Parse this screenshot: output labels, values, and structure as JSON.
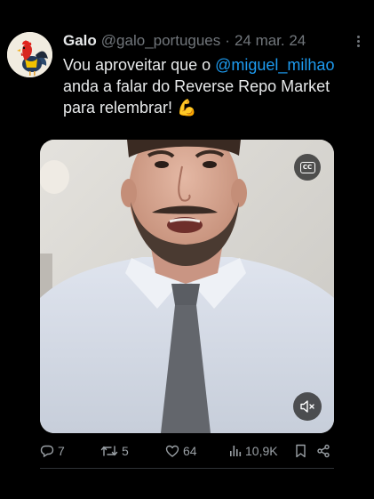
{
  "tweet": {
    "author_name": "Galo",
    "handle": "@galo_portugues",
    "separator": "·",
    "date": "24 mar. 24",
    "text_prefix": "Vou aproveitar que o ",
    "mention": "@miguel_milhao",
    "text_line2": "anda a falar do Reverse Repo Market",
    "text_line3": "para relembrar! 💪"
  },
  "video": {
    "captions_icon": "cc-icon",
    "captions_label": "CC",
    "mute_icon": "speaker-muted-icon"
  },
  "actions": {
    "replies": "7",
    "reposts": "5",
    "likes": "64",
    "views": "10,9K"
  },
  "colors": {
    "background": "#000000",
    "text": "#e7e9ea",
    "muted": "#71767b",
    "link": "#1d9bf0",
    "divider": "#2f3336"
  }
}
